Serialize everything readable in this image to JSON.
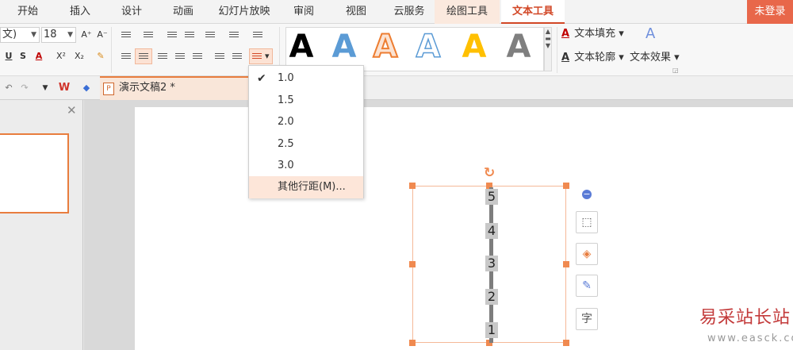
{
  "tabs": [
    "开始",
    "插入",
    "设计",
    "动画",
    "幻灯片放映",
    "审阅",
    "视图",
    "云服务",
    "绘图工具",
    "文本工具"
  ],
  "login": "未登录",
  "font": {
    "name": "文)",
    "size": "18"
  },
  "format_buttons": {
    "grow": "A⁺",
    "shrink": "A⁻",
    "underline": "U",
    "strike": "S",
    "font_color": "A",
    "superscript": "X²",
    "subscript": "X₂"
  },
  "text_styles": {
    "glyph": "A",
    "colors": [
      "#000000",
      "#5b9bd5",
      "#ed7d31",
      "#ffffff",
      "#ffc000",
      "#7f7f7f"
    ]
  },
  "text_options": {
    "fill": "文本填充",
    "outline": "文本轮廓",
    "effect": "文本效果"
  },
  "document": {
    "title": "演示文稿2 *"
  },
  "line_spacing_menu": {
    "options": [
      "1.0",
      "1.5",
      "2.0",
      "2.5",
      "3.0"
    ],
    "selected": "1.0",
    "other": "其他行距(M)..."
  },
  "textbox": {
    "numbers": [
      "5",
      "4",
      "3",
      "2",
      "1"
    ]
  },
  "side_buttons": [
    "shape-style",
    "fill",
    "outline",
    "text"
  ],
  "watermark": {
    "main": "易采站长站",
    "sub": "www.easck.com"
  }
}
